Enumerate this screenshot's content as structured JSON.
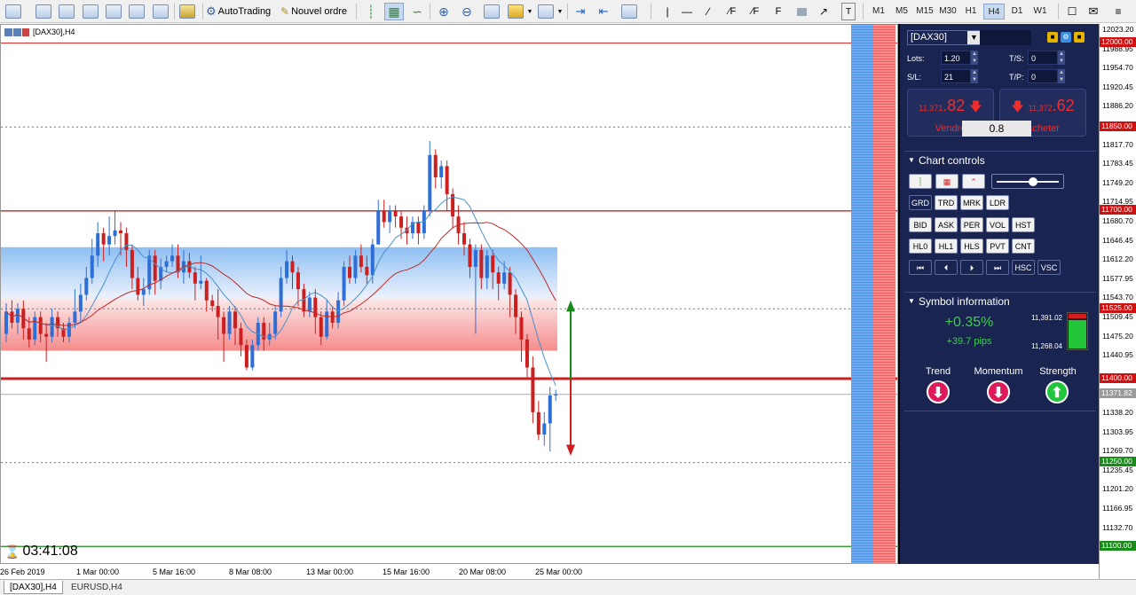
{
  "toolbar": {
    "autotrading_label": "AutoTrading",
    "new_order_label": "Nouvel ordre",
    "timeframes": [
      "M1",
      "M5",
      "M15",
      "M30",
      "H1",
      "H4",
      "D1",
      "W1"
    ],
    "active_timeframe": "H4"
  },
  "chart": {
    "title": "[DAX30],H4",
    "countdown": "03:41:08",
    "x_ticks": [
      "26 Feb 2019",
      "1 Mar 00:00",
      "5 Mar 16:00",
      "8 Mar 08:00",
      "13 Mar 00:00",
      "15 Mar 16:00",
      "20 Mar 08:00",
      "25 Mar 00:00"
    ],
    "y_ticks": [
      "12023.20",
      "11988.95",
      "11954.70",
      "11920.45",
      "11886.20",
      "11817.70",
      "11783.45",
      "11749.20",
      "11714.95",
      "11680.70",
      "11646.45",
      "11612.20",
      "11577.95",
      "11543.70",
      "11509.45",
      "11475.20",
      "11440.95",
      "11338.20",
      "11303.95",
      "11269.70",
      "11235.45",
      "11201.20",
      "11166.95",
      "11132.70"
    ],
    "price_labels": [
      {
        "text": "12000.00",
        "color": "#d01010"
      },
      {
        "text": "11850.00",
        "color": "#d01010"
      },
      {
        "text": "11700.00",
        "color": "#d01010"
      },
      {
        "text": "11525.00",
        "color": "#d01010"
      },
      {
        "text": "11400.00",
        "color": "#d01010"
      },
      {
        "text": "11371.82",
        "color": "#9a9a9a"
      },
      {
        "text": "11250.00",
        "color": "#1a8a1a"
      },
      {
        "text": "11100.00",
        "color": "#1a8a1a"
      }
    ],
    "colors": {
      "bull": "#2d6fd6",
      "bear": "#cc2020",
      "support_line": "#cc2020",
      "arrow_up": "#1a8a1a",
      "arrow_down": "#cc2020"
    }
  },
  "panel": {
    "symbol": "[DAX30]",
    "lots_label": "Lots:",
    "lots_value": "1.20",
    "sl_label": "S/L:",
    "sl_value": "21",
    "ts_label": "T/S:",
    "ts_value": "0",
    "tp_label": "T/P:",
    "tp_value": "0",
    "sell_prefix": "11,371",
    "sell_suffix": ".82",
    "sell_label": "Vendre",
    "buy_prefix": "11,372",
    "buy_suffix": ".62",
    "buy_label": "Acheter",
    "spread": "0.8",
    "chart_controls_title": "Chart controls",
    "control_rows": [
      [
        "GRD",
        "TRD",
        "MRK",
        "LDR"
      ],
      [
        "BID",
        "ASK",
        "PER",
        "VOL",
        "HST"
      ],
      [
        "HL0",
        "HL1",
        "HLS",
        "PVT",
        "CNT"
      ],
      [
        "⏮",
        "⏴",
        "⏵",
        "⏭",
        "HSC",
        "VSC"
      ]
    ],
    "symbol_info_title": "Symbol information",
    "change_pct": "+0.35%",
    "change_pips": "+39.7 pips",
    "range_high": "11,391.02",
    "range_low": "11,268.04",
    "range_position": 0.78,
    "trend_label": "Trend",
    "momentum_label": "Momentum",
    "strength_label": "Strength",
    "trend_dir": "down",
    "momentum_dir": "down",
    "strength_dir": "up"
  },
  "tabs": [
    "[DAX30],H4",
    "EURUSD,H4"
  ]
}
